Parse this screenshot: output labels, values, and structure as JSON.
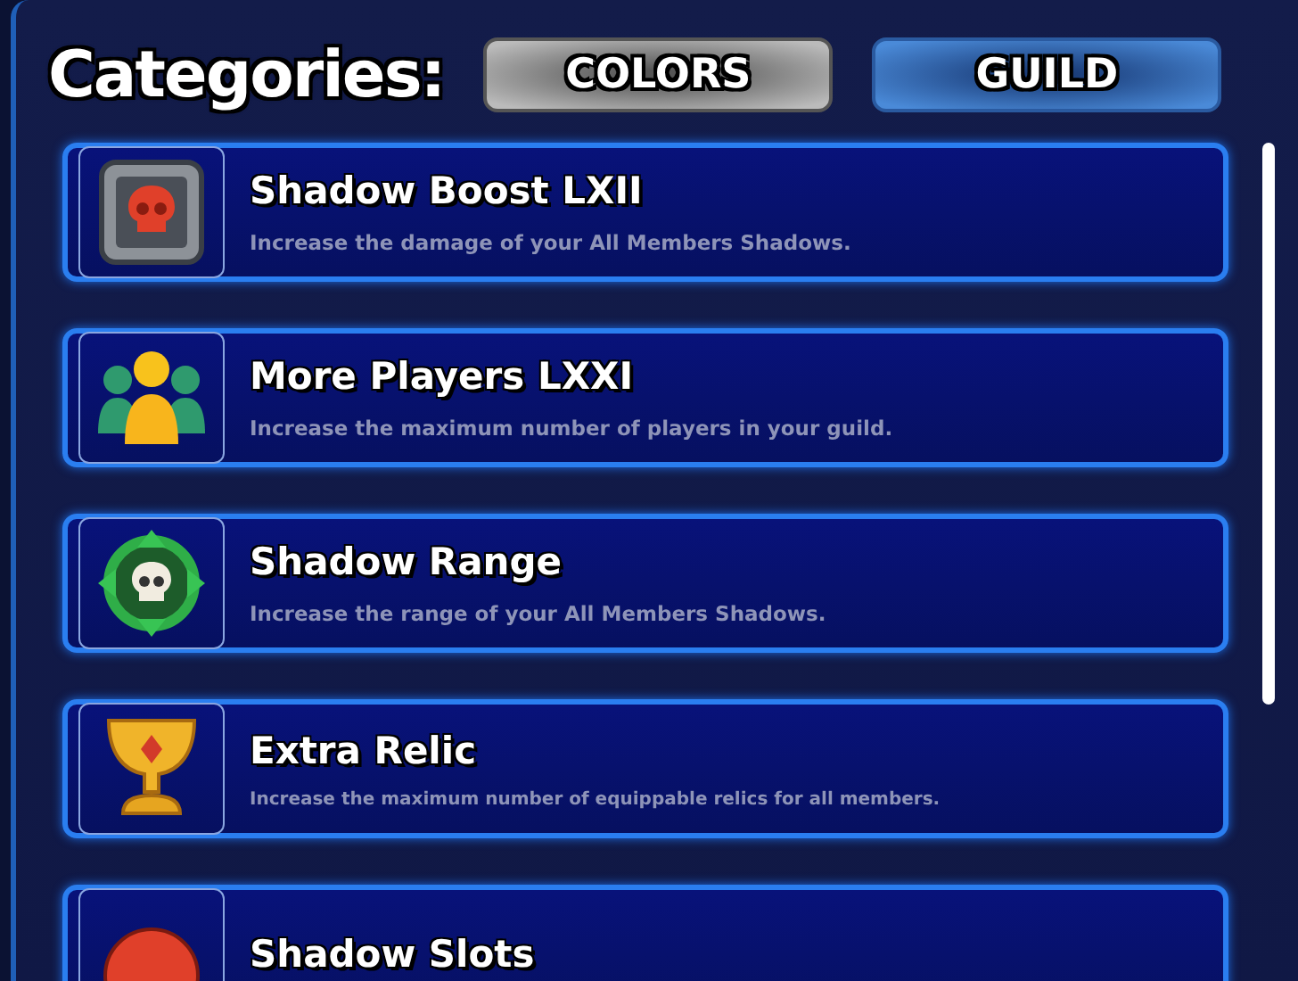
{
  "header": {
    "title": "Categories:"
  },
  "tabs": [
    {
      "label": "COLORS",
      "selected": false
    },
    {
      "label": "GUILD",
      "selected": true
    }
  ],
  "upgrades": [
    {
      "kind": "skull-badge",
      "title": "Shadow Boost LXII",
      "description": "Increase the damage of your All Members Shadows."
    },
    {
      "kind": "players",
      "title": "More Players LXXI",
      "description": "Increase the maximum number of players in your guild."
    },
    {
      "kind": "range",
      "title": "Shadow Range",
      "description": "Increase the range of your All Members Shadows."
    },
    {
      "kind": "chalice",
      "title": "Extra Relic",
      "description": "Increase the maximum number of equippable relics for all members.",
      "small": true
    },
    {
      "kind": "red-orb",
      "title": "Shadow Slots"
    }
  ]
}
